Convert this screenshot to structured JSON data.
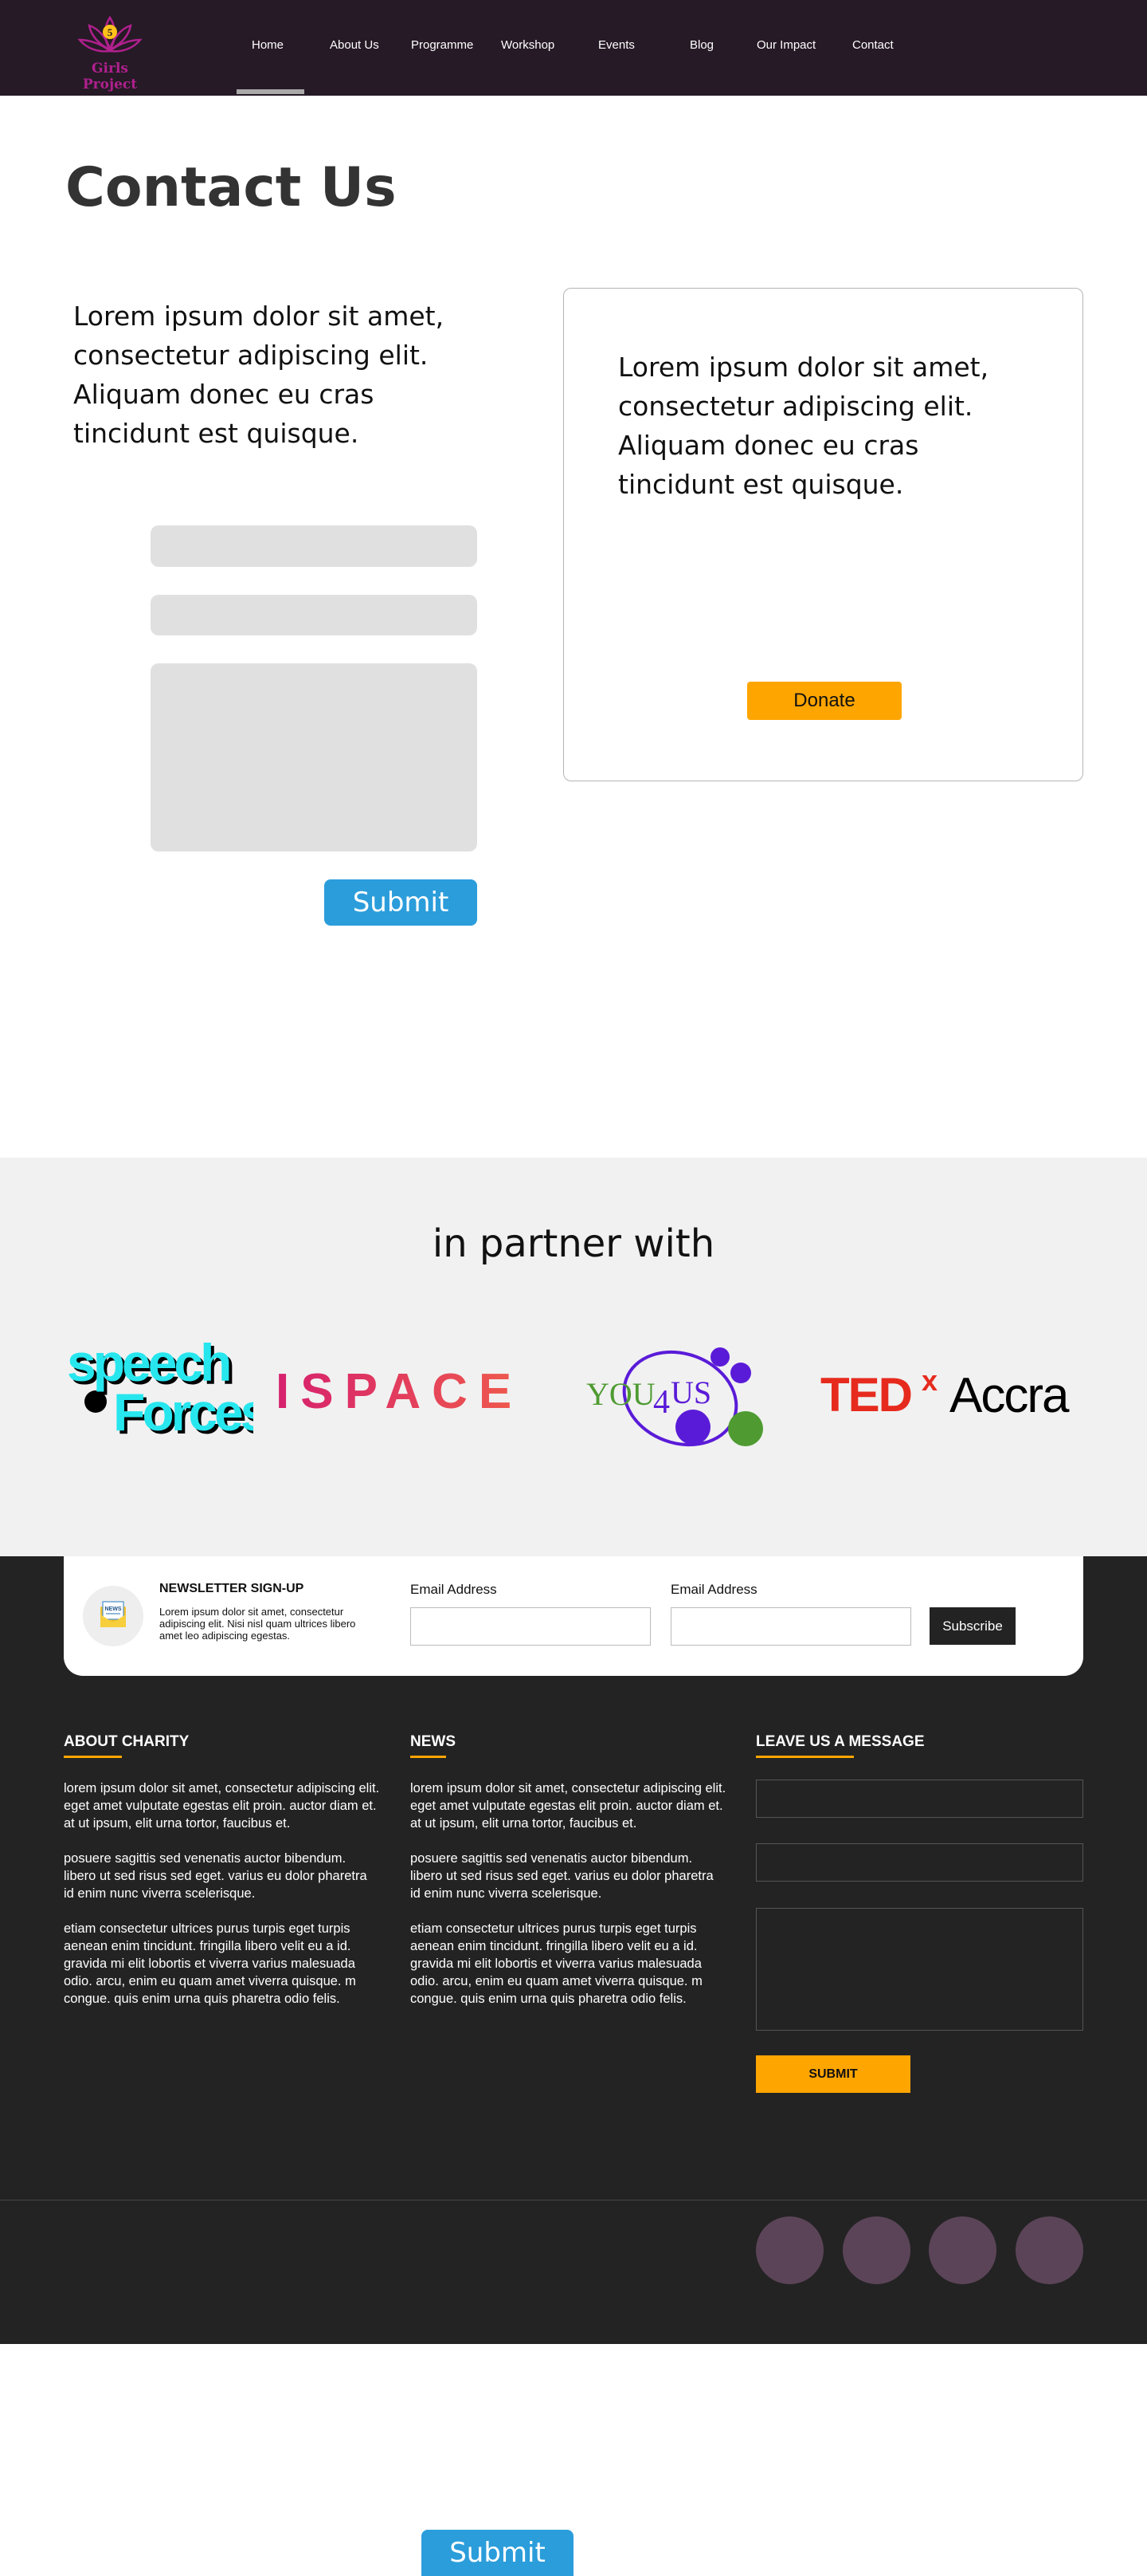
{
  "nav": {
    "logo_text": "Girls Project",
    "items": [
      {
        "label": "Home"
      },
      {
        "label": "About Us"
      },
      {
        "label": "Programme"
      },
      {
        "label": "Workshop"
      },
      {
        "label": "Events"
      },
      {
        "label": "Blog"
      },
      {
        "label": "Our Impact"
      },
      {
        "label": "Contact"
      }
    ],
    "active_index": 0
  },
  "contact": {
    "title": "Contact Us",
    "intro": "Lorem ipsum dolor sit amet, consectetur adipiscing elit. Aliquam donec eu cras tincidunt est quisque.",
    "submit_label": "Submit"
  },
  "donate": {
    "text": "Lorem ipsum dolor sit amet, consectetur adipiscing elit. Aliquam donec eu cras tincidunt est quisque.",
    "button_label": "Donate"
  },
  "partners": {
    "title": "in partner with",
    "logos": [
      {
        "name": "speech-forces",
        "line1": "speech",
        "line2": "Forces"
      },
      {
        "name": "ispace",
        "text": "ISPACE"
      },
      {
        "name": "you4us",
        "text_a": "YOU",
        "text_b": "4",
        "text_c": "US"
      },
      {
        "name": "tedx-accra",
        "ted": "TED",
        "x": "x",
        "city": "Accra"
      }
    ]
  },
  "newsletter": {
    "title": "NEWSLETTER SIGN-UP",
    "icon_text": "NEWS",
    "description": "Lorem ipsum dolor sit amet, consectetur adipiscing elit. Nisi nisl quam ultrices libero amet leo adipiscing egestas.",
    "email_label_1": "Email Address",
    "email_label_2": "Email Address",
    "subscribe_label": "Subscribe"
  },
  "footer": {
    "about": {
      "title": "ABOUT CHARITY",
      "paragraphs": [
        "lorem ipsum dolor sit amet, consectetur adipiscing elit. eget amet vulputate egestas elit proin. auctor diam et. at ut ipsum, elit urna tortor, faucibus et.",
        "posuere sagittis sed venenatis auctor bibendum. libero ut sed risus sed eget. varius eu dolor pharetra id enim nunc viverra scelerisque.",
        "etiam consectetur ultrices purus turpis eget turpis aenean enim tincidunt. fringilla libero velit eu a id. gravida mi elit lobortis et viverra varius malesuada odio. arcu, enim eu quam amet viverra quisque. m congue. quis enim urna quis pharetra odio felis."
      ]
    },
    "news": {
      "title": "NEWS",
      "paragraphs": [
        "lorem ipsum dolor sit amet, consectetur adipiscing elit. eget amet vulputate egestas elit proin. auctor diam et. at ut ipsum, elit urna tortor, faucibus et.",
        "posuere sagittis sed venenatis auctor bibendum. libero ut sed risus sed eget. varius eu dolor pharetra id enim nunc viverra scelerisque.",
        "etiam consectetur ultrices purus turpis eget turpis aenean enim tincidunt. fringilla libero velit eu a id. gravida mi elit lobortis et viverra varius malesuada odio. arcu, enim eu quam amet viverra quisque. m congue. quis enim urna quis pharetra odio felis."
      ]
    },
    "message": {
      "title": "LEAVE US A MESSAGE",
      "submit_label": "SUBMIT"
    },
    "social_count": 4
  },
  "bottom": {
    "submit_label": "Submit"
  },
  "colors": {
    "nav_bg": "#261a26",
    "accent_orange": "#ffa500",
    "accent_blue": "#2b9ddb",
    "footer_bg": "#232323",
    "partners_bg": "#f1f1f1",
    "social_circle": "#5b4458"
  }
}
